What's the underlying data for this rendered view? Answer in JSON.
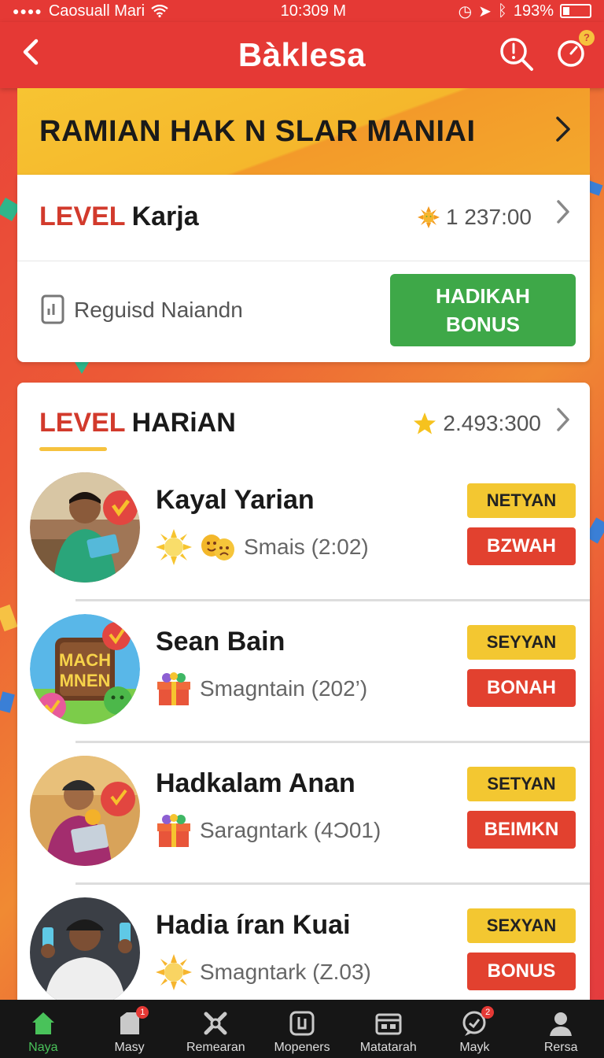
{
  "status_bar": {
    "carrier": "Caosuall Mari",
    "time": "10:309 M",
    "battery": "193%"
  },
  "header": {
    "back_icon": "back-chevron-icon",
    "title": "Bàklesa",
    "search_icon": "search-icon",
    "timer_icon": "timer-icon",
    "timer_badge": "?"
  },
  "promo": {
    "text": "RAMIAN HAK N SLAR MANIAI"
  },
  "level_card": {
    "title_red": "LEVEL",
    "title_black": "Karja",
    "points": "1 237:00",
    "requirement_label": "Reguisd Naiandn",
    "bonus_button_line1": "HADIKAH",
    "bonus_button_line2": "BONUS"
  },
  "harian": {
    "title_red": "LEVEL",
    "title_black": "HARiAN",
    "points": "2.493:300",
    "entries": [
      {
        "name": "Kayal Yarian",
        "sub": "Smais (2:02)",
        "btn_top": "NETYAN",
        "btn_bottom": "BZWAH"
      },
      {
        "name": "Sean Bain",
        "sub": "Smagntain (202’)",
        "btn_top": "SEYYAN",
        "btn_bottom": "BONAH"
      },
      {
        "name": "Hadkalam Anan",
        "sub": "Saragntark (4Ɔ01)",
        "btn_top": "SETYAN",
        "btn_bottom": "BEIMKN"
      },
      {
        "name": "Hadia íran Kuai",
        "sub": "Smagntark (Z.03)",
        "btn_top": "SEXYAN",
        "btn_bottom": "BONUS"
      }
    ],
    "avatar2_text_line1": "MACH",
    "avatar2_text_line2": "MNEN"
  },
  "bottom_nav": [
    {
      "label": "Naya",
      "icon": "home-icon",
      "active": true
    },
    {
      "label": "Masy",
      "icon": "box-icon",
      "badge": "1"
    },
    {
      "label": "Remearan",
      "icon": "tools-icon"
    },
    {
      "label": "Mopeners",
      "icon": "card-icon"
    },
    {
      "label": "Matatarah",
      "icon": "wallet-icon"
    },
    {
      "label": "Mayk",
      "icon": "chat-icon",
      "badge": "2"
    },
    {
      "label": "Rersa",
      "icon": "user-icon"
    }
  ],
  "colors": {
    "header_red": "#e53935",
    "banner_yellow": "#f7c432",
    "bonus_green": "#3ea848",
    "button_yellow": "#f3c731",
    "button_red": "#e2412f"
  }
}
